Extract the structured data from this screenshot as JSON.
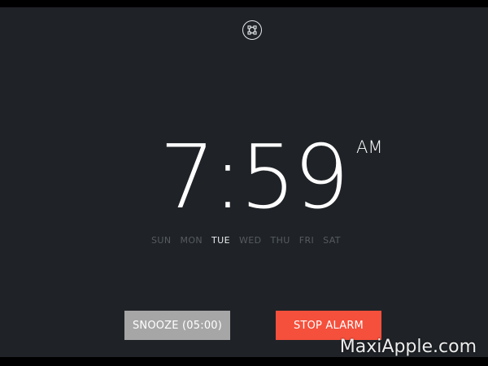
{
  "alarm": {
    "time": "7:59",
    "meridiem": "AM",
    "days": [
      {
        "label": "SUN",
        "active": false
      },
      {
        "label": "MON",
        "active": false
      },
      {
        "label": "TUE",
        "active": true
      },
      {
        "label": "WED",
        "active": false
      },
      {
        "label": "THU",
        "active": false
      },
      {
        "label": "FRI",
        "active": false
      },
      {
        "label": "SAT",
        "active": false
      }
    ],
    "fullscreen_icon": "fullscreen-icon"
  },
  "actions": {
    "snooze_label": "SNOOZE (05:00)",
    "stop_label": "STOP ALARM"
  },
  "watermark": "MaxiApple.com",
  "colors": {
    "background": "#1f2327",
    "snooze": "#a6a6a6",
    "stop": "#f5503c",
    "day_active": "#e9ebed",
    "day_inactive": "#565b60"
  }
}
